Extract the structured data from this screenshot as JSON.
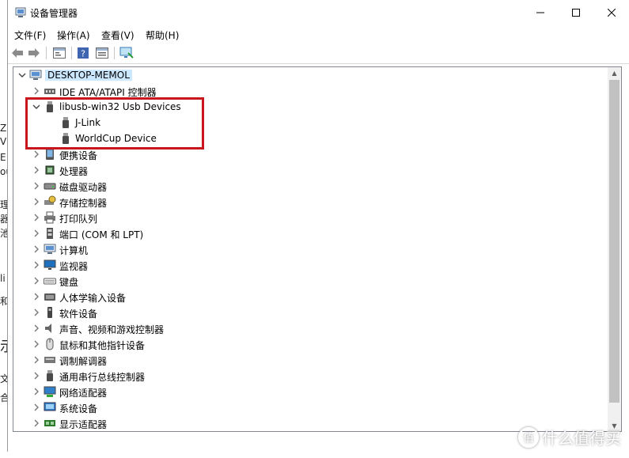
{
  "window": {
    "title": "设备管理器"
  },
  "menu": [
    "文件(F)",
    "操作(A)",
    "查看(V)",
    "帮助(H)"
  ],
  "toolbar": {
    "buttons": [
      "back-arrow-icon",
      "forward-arrow-icon",
      "properties-icon",
      "help-icon",
      "view-icon",
      "monitor-scan-icon"
    ]
  },
  "bg_glyphs": [
    "Z",
    "V",
    "E",
    "ou",
    "理",
    "器",
    "池",
    "li",
    "和",
    "示",
    "文",
    "合"
  ],
  "tree": {
    "root": "DESKTOP-MEMOL",
    "items": [
      {
        "label": "IDE ATA/ATAPI 控制器",
        "icon": "ide-controller-icon",
        "level": 1,
        "expanded": false
      },
      {
        "label": "libusb-win32 Usb Devices",
        "icon": "usb-device-icon",
        "level": 1,
        "expanded": true
      },
      {
        "label": "J-Link",
        "icon": "usb-device-icon",
        "level": 2,
        "expanded": null
      },
      {
        "label": "WorldCup Device",
        "icon": "usb-device-icon",
        "level": 2,
        "expanded": null
      },
      {
        "label": "便携设备",
        "icon": "portable-device-icon",
        "level": 1,
        "expanded": false
      },
      {
        "label": "处理器",
        "icon": "processor-icon",
        "level": 1,
        "expanded": false
      },
      {
        "label": "磁盘驱动器",
        "icon": "disk-drive-icon",
        "level": 1,
        "expanded": false
      },
      {
        "label": "存储控制器",
        "icon": "storage-controller-icon",
        "level": 1,
        "expanded": false
      },
      {
        "label": "打印队列",
        "icon": "printer-icon",
        "level": 1,
        "expanded": false
      },
      {
        "label": "端口 (COM 和 LPT)",
        "icon": "port-icon",
        "level": 1,
        "expanded": false
      },
      {
        "label": "计算机",
        "icon": "computer-icon",
        "level": 1,
        "expanded": false
      },
      {
        "label": "监视器",
        "icon": "monitor-icon",
        "level": 1,
        "expanded": false
      },
      {
        "label": "键盘",
        "icon": "keyboard-icon",
        "level": 1,
        "expanded": false
      },
      {
        "label": "人体学输入设备",
        "icon": "hid-icon",
        "level": 1,
        "expanded": false
      },
      {
        "label": "软件设备",
        "icon": "software-device-icon",
        "level": 1,
        "expanded": false
      },
      {
        "label": "声音、视频和游戏控制器",
        "icon": "speaker-icon",
        "level": 1,
        "expanded": false
      },
      {
        "label": "鼠标和其他指针设备",
        "icon": "mouse-icon",
        "level": 1,
        "expanded": false
      },
      {
        "label": "调制解调器",
        "icon": "modem-icon",
        "level": 1,
        "expanded": false
      },
      {
        "label": "通用串行总线控制器",
        "icon": "usb-controller-icon",
        "level": 1,
        "expanded": false
      },
      {
        "label": "网络适配器",
        "icon": "network-adapter-icon",
        "level": 1,
        "expanded": false
      },
      {
        "label": "系统设备",
        "icon": "system-device-icon",
        "level": 1,
        "expanded": false
      },
      {
        "label": "显示适配器",
        "icon": "display-adapter-icon",
        "level": 1,
        "expanded": false
      }
    ]
  },
  "watermark": {
    "text": "什么值得买",
    "icon_glyph": "值"
  },
  "colors": {
    "highlight_border": "#c9151e",
    "root_selection": "#cce8ff"
  }
}
